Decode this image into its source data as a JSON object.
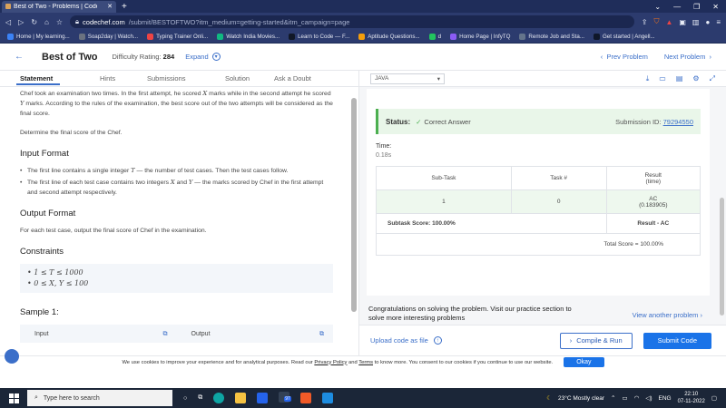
{
  "browser": {
    "tab_title": "Best of Two - Problems | CodeChef",
    "url_host": "codechef.com",
    "url_path": "/submit/BESTOFTWO?itm_medium=getting-started&itm_campaign=page",
    "bookmarks": [
      {
        "label": "Home | My learning...",
        "color": "#3b82f6"
      },
      {
        "label": "Soap2day | Watch...",
        "color": "#6b7280"
      },
      {
        "label": "Typing Trainer Onli...",
        "color": "#ef4444"
      },
      {
        "label": "Watch India Movies...",
        "color": "#10b981"
      },
      {
        "label": "Learn to Code — F...",
        "color": "#111827"
      },
      {
        "label": "Aptitude Questions...",
        "color": "#f59e0b"
      },
      {
        "label": "d",
        "color": "#22c55e"
      },
      {
        "label": "Home Page | InfyTQ",
        "color": "#8b5cf6"
      },
      {
        "label": "Remote Job and Sta...",
        "color": "#64748b"
      },
      {
        "label": "Get started | Angell...",
        "color": "#0f172a"
      }
    ]
  },
  "header": {
    "title": "Best of Two",
    "difficulty_label": "Difficulty Rating:",
    "difficulty_value": "284",
    "expand_label": "Expand",
    "prev_label": "Prev Problem",
    "next_label": "Next Problem"
  },
  "tabs": [
    "Statement",
    "Hints",
    "Submissions",
    "Solution",
    "Ask a Doubt"
  ],
  "statement": {
    "intro_1": "Chef took an examination two times. In the first attempt, he scored ",
    "var_x": "X",
    "intro_2": " marks while in the second attempt he scored ",
    "var_y": "Y",
    "intro_3": " marks. According to the rules of the examination, the best score out of the two attempts will be considered as the final score.",
    "task": "Determine the final score of the Chef.",
    "input_heading": "Input Format",
    "input_1a": "The first line contains a single integer ",
    "var_t": "T",
    "input_1b": " — the number of test cases. Then the test cases follow.",
    "input_2a": "The first line of each test case contains two integers ",
    "input_2b": " and ",
    "input_2c": " — the marks scored by Chef in the first attempt and second attempt respectively.",
    "output_heading": "Output Format",
    "output_text": "For each test case, output the final score of Chef in the examination.",
    "constraints_heading": "Constraints",
    "constraint_1": "1 ≤ T ≤ 1000",
    "constraint_2": "0 ≤ X, Y ≤ 100",
    "sample_heading": "Sample 1:",
    "sample_input": "Input",
    "sample_output": "Output"
  },
  "editor": {
    "language": "JAVA"
  },
  "result": {
    "status_label": "Status:",
    "status_value": "Correct Answer",
    "submission_label": "Submission ID:",
    "submission_id": "79294550",
    "time_label": "Time:",
    "time_value": "0.18s",
    "col_subtask": "Sub-Task",
    "col_task": "Task #",
    "col_result": "Result",
    "col_result_sub": "(time)",
    "row_subtask": "1",
    "row_task": "0",
    "row_result": "AC",
    "row_time": "(0.183905)",
    "subtask_score": "Subtask Score: 100.00%",
    "result_summary": "Result - AC",
    "total_score": "Total Score = 100.00%"
  },
  "congrats": {
    "text": "Congratulations on solving the problem. Visit our practice section to solve more interesting problems",
    "view_another": "View another problem"
  },
  "actions": {
    "upload": "Upload code as file",
    "compile": "Compile & Run",
    "submit": "Submit Code"
  },
  "cookie": {
    "text_1": "We use cookies to improve your experience and for analytical purposes. Read our ",
    "privacy": "Privacy Policy",
    "text_2": " and ",
    "terms": "Terms",
    "text_3": " to know more. You consent to our cookies if you continue to use our website.",
    "okay": "Okay"
  },
  "taskbar": {
    "search_placeholder": "Type here to search",
    "badge": "97",
    "weather": "23°C  Mostly clear",
    "lang": "ENG",
    "time": "22:10",
    "date": "07-11-2022"
  }
}
